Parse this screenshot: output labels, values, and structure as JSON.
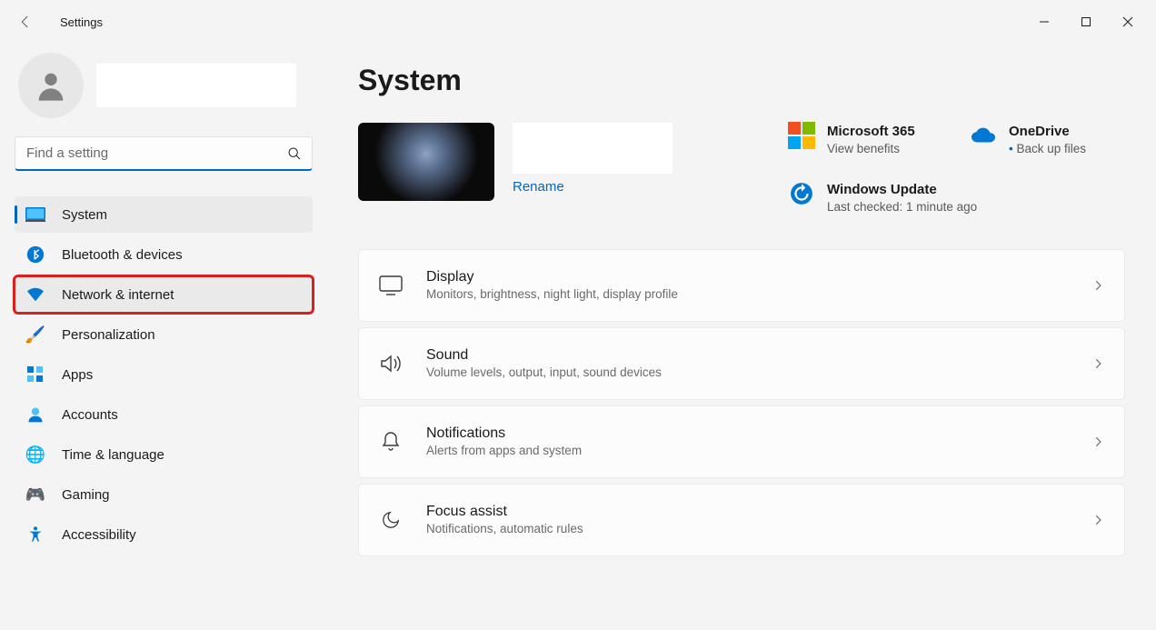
{
  "app_title": "Settings",
  "search_placeholder": "Find a setting",
  "nav": [
    {
      "label": "System",
      "icon": "💻"
    },
    {
      "label": "Bluetooth & devices",
      "icon": "bt"
    },
    {
      "label": "Network & internet",
      "icon": "wifi"
    },
    {
      "label": "Personalization",
      "icon": "🖌️"
    },
    {
      "label": "Apps",
      "icon": "apps"
    },
    {
      "label": "Accounts",
      "icon": "👤"
    },
    {
      "label": "Time & language",
      "icon": "🌐"
    },
    {
      "label": "Gaming",
      "icon": "🎮"
    },
    {
      "label": "Accessibility",
      "icon": "acc"
    }
  ],
  "page_title": "System",
  "rename_label": "Rename",
  "quick": {
    "m365": {
      "title": "Microsoft 365",
      "sub": "View benefits"
    },
    "onedrive": {
      "title": "OneDrive",
      "sub": "Back up files"
    },
    "update": {
      "title": "Windows Update",
      "sub": "Last checked: 1 minute ago"
    }
  },
  "settings": [
    {
      "title": "Display",
      "sub": "Monitors, brightness, night light, display profile"
    },
    {
      "title": "Sound",
      "sub": "Volume levels, output, input, sound devices"
    },
    {
      "title": "Notifications",
      "sub": "Alerts from apps and system"
    },
    {
      "title": "Focus assist",
      "sub": "Notifications, automatic rules"
    }
  ]
}
